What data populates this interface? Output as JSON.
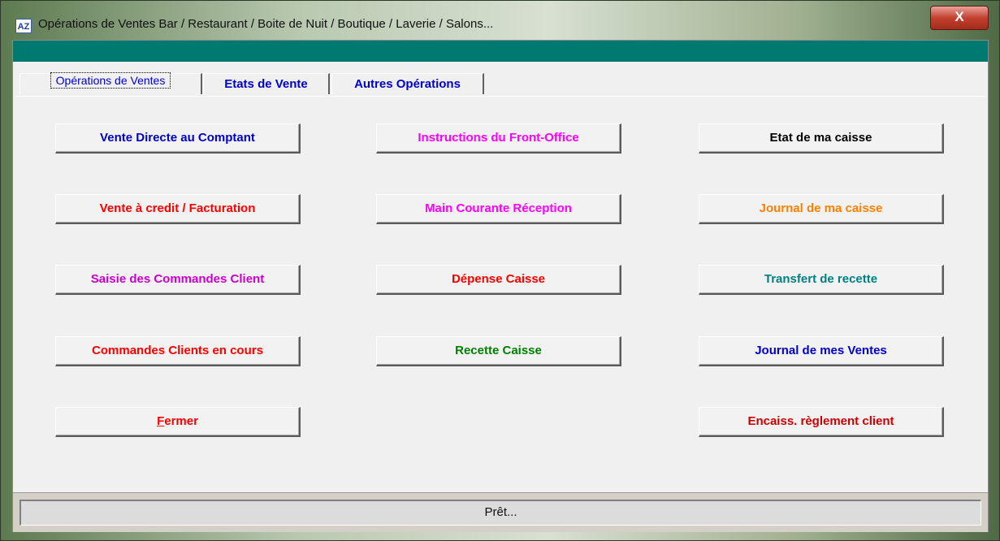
{
  "window": {
    "title": "Opérations de Ventes Bar / Restaurant / Boite de Nuit / Boutique / Laverie / Salons...",
    "icon_label": "AZ",
    "close_label": "X"
  },
  "tabs": [
    {
      "label": "Opérations de Ventes",
      "active": true
    },
    {
      "label": "Etats de Vente",
      "active": false
    },
    {
      "label": "Autres Opérations",
      "active": false
    }
  ],
  "buttons": {
    "col1": [
      {
        "label": "Vente Directe au Comptant",
        "color": "#0000cc"
      },
      {
        "label": "Vente à credit / Facturation",
        "color": "#ff0000"
      },
      {
        "label": "Saisie des Commandes Client",
        "color": "#cc00cc"
      },
      {
        "label": "Commandes Clients en cours",
        "color": "#ff0000"
      },
      {
        "label": "Fermer",
        "color": "#ff0000",
        "accel": "F",
        "rest": "ermer"
      }
    ],
    "col2": [
      {
        "label": "Instructions du Front-Office",
        "color": "#ff00ff"
      },
      {
        "label": "Main Courante Réception",
        "color": "#ff00ff"
      },
      {
        "label": "Dépense Caisse",
        "color": "#ff0000"
      },
      {
        "label": "Recette Caisse",
        "color": "#008000"
      }
    ],
    "col3": [
      {
        "label": "Etat de ma caisse",
        "color": "#000000"
      },
      {
        "label": "Journal de ma caisse",
        "color": "#ff8000"
      },
      {
        "label": "Transfert de recette",
        "color": "#008080"
      },
      {
        "label": "Journal de mes Ventes",
        "color": "#0000cc"
      },
      {
        "label": "Encaiss. règlement client",
        "color": "#cc0000"
      }
    ]
  },
  "status": {
    "text": "Prêt..."
  },
  "colors": {
    "header_strip": "#007a70",
    "client_bg": "#f0f0f0"
  }
}
